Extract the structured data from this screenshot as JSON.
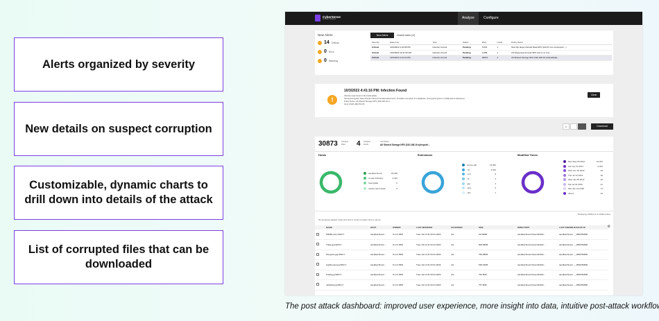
{
  "features": [
    "Alerts organized by severity",
    "New details on suspect corruption",
    "Customizable, dynamic charts to drill down into details of the attack",
    "List of corrupted files that can be downloaded"
  ],
  "caption": "The post attack dashboard: improved user experience, more insight into data, intuitive post-attack workflow.",
  "app": {
    "logo": "CyberSense",
    "logo_sub": "by Index Engines",
    "nav": [
      "Analyze",
      "Configure"
    ]
  },
  "alerts": {
    "title": "New Alerts",
    "severity": [
      {
        "count": "14",
        "label": "Critical",
        "color": "#f5a623"
      },
      {
        "count": "0",
        "label": "Error",
        "color": "#f5a623"
      },
      {
        "count": "0",
        "label": "Warning",
        "color": "#f5a623"
      }
    ],
    "tabs": [
      "New Alerts",
      "Cleared Alerts (11)"
    ],
    "columns": [
      "Severity",
      "Date-time",
      "Type",
      "Status",
      "Files",
      "Hosts",
      "Policy Name"
    ],
    "rows": [
      [
        "Critical",
        "10/3/2022 4:42:59 PM",
        "Infection Found",
        "Pending",
        "5,015",
        "1",
        "New Zip large Infected Data NFS (100.67.1xx.xxx/export/...)"
      ],
      [
        "Critical",
        "10/3/2022 10:11:50 AM",
        "Infection Found",
        "Pending",
        "3,089",
        "1",
        "CS-Dispersed-sU-test-NFS (10.xx.xx.xxx) ..."
      ],
      [
        "Critical",
        "10/3/2022 4:41:16 PM",
        "Infection Found",
        "Pending",
        "30873",
        "4",
        "All Shared Storage NFS (192.168.19.x/abcd/data)..."
      ]
    ]
  },
  "detail": {
    "title": "10/3/2022 4:41:16 PM: Infection Found",
    "lines": [
      "Infection was found in the backupdata",
      "Strong Encryption Files-Infection Recommended Extensions: Possible corruption of a database. Strong Encryption in OldSystems Filenames.",
      "Policy Name: All Shared Storage NFS (192.168.19.x) ...",
      "Host: ASHC-ZECS3-OF"
    ],
    "button": "Clear"
  },
  "summary": {
    "files_count": "30873",
    "files_label": "Suspect Files",
    "hosts_count": "4",
    "hosts_label": "Suspect Hosts",
    "job_label": "Job Name",
    "job_value": "All Shared Storage NFS (192.168.19.x)/export/...",
    "download": "Download"
  },
  "charts": {
    "hosts": {
      "title": "Hosts",
      "color": "#3ab86a",
      "items": [
        {
          "label": "sandiacchmem..",
          "value": "18,469",
          "color": "#2e9e55"
        },
        {
          "label": "cs-sas-infecting..",
          "value": "2,322",
          "color": "#4cc07a"
        },
        {
          "label": "freezydata",
          "value": "0",
          "color": "#7fd6a0"
        },
        {
          "label": "oracle-macro-data..",
          "value": "0",
          "color": "#b5e8c8"
        }
      ]
    },
    "extensions": {
      "title": "Extensions",
      "color": "#3aa4d8",
      "items": [
        {
          "label": "secure.pdf",
          "value": "12,381",
          "color": "#1f7fb8"
        },
        {
          "label": ".txt",
          "value": "2,022",
          "color": "#3aa4d8"
        },
        {
          "label": ".xml",
          "value": "5",
          "color": "#5bb6e0"
        },
        {
          "label": ".rtf",
          "value": "4",
          "color": "#7cc7e8"
        },
        {
          "label": ".jpg",
          "value": "4",
          "color": "#9dd6ef"
        },
        {
          "label": ".png",
          "value": "3",
          "color": "#bde4f4"
        },
        {
          "label": ".doc",
          "value": "1",
          "color": "#dceff9"
        }
      ]
    },
    "modified": {
      "title": "Modified Times",
      "color": "#6a2fc9",
      "items": [
        {
          "label": "Mon May 09 2012",
          "value": "12,331",
          "color": "#4a1ea0"
        },
        {
          "label": "Sun Apr 23 2017",
          "value": "2,022",
          "color": "#6a2fc9"
        },
        {
          "label": "Wed Jun 19 2019",
          "value": "49",
          "color": "#8450d8"
        },
        {
          "label": "Thu Jul 11 2019",
          "value": "26",
          "color": "#9d72e0"
        },
        {
          "label": "Wed Jan 05 2012",
          "value": "26",
          "color": "#b594e8"
        },
        {
          "label": "Sat Jul 04 2015",
          "value": "21",
          "color": "#cbb4ef"
        },
        {
          "label": "Mon Apr 16 2018",
          "value": "11",
          "color": "#ddd0f5"
        },
        {
          "label": "others",
          "value": "24",
          "color": "#6a2fc9"
        }
      ]
    },
    "display_note": "Displaying 15408 out of 15408 entries",
    "grouping_note": "No grouping applied. Drag and drop a column header here to group."
  },
  "files": {
    "columns": [
      "NAME",
      "HOST",
      "OWNER",
      "LAST MODIFIED",
      "ACCESSED",
      "SIZE",
      "DIRECTORY",
      "LAST KNOWN BACKUP ID"
    ],
    "rows": [
      [
        "Wildfile.wmv.WNCY",
        "sandiacchmem...",
        "S-1-5-1500",
        "Tues Jul 14 01:33:31 2020",
        "n/a",
        "23.03MB",
        "sandiacchmem/Users/Public...",
        "sandiacchmem..._1506784800"
      ],
      [
        "Tulips.jpg.WNCY",
        "sandiacchmem...",
        "S-1-5-1500",
        "Tues Jul 14 01:33:31 2020",
        "n/a",
        "606.83KB",
        "sandiacchmem/Users/Public...",
        "sandiacchmem..._1506784800"
      ],
      [
        "Penguins.jpg.WNCY",
        "sandiacchmem...",
        "S-1-5-1500",
        "Tues Jul 14 01:33:31 2020",
        "n/a",
        "759.28KB",
        "sandiacchmem/Users/Public...",
        "sandiacchmem..._1506784800"
      ],
      [
        "Lighthouse.jpg.WNCY",
        "sandiacchmem...",
        "S-1-5-1500",
        "Tues Jul 14 01:33:31 2020",
        "n/a",
        "548.34KB",
        "sandiacchmem/Users/Public...",
        "sandiacchmem..._1506784800"
      ],
      [
        "Koala.jpg.WNCY",
        "sandiacchmem...",
        "S-1-5-1500",
        "Tues Jul 14 01:33:31 2020",
        "n/a",
        "762.5KB",
        "sandiacchmem/Users/Public...",
        "sandiacchmem..._1506784800"
      ],
      [
        "Jellyfish.jpg.WNCY",
        "sandiacchmem...",
        "S-1-5-1500",
        "Tues Jul 14 01:33:31 2020",
        "n/a",
        "757.5KB",
        "sandiacchmem/Users/Public...",
        "sandiacchmem..._1506784800"
      ]
    ]
  }
}
